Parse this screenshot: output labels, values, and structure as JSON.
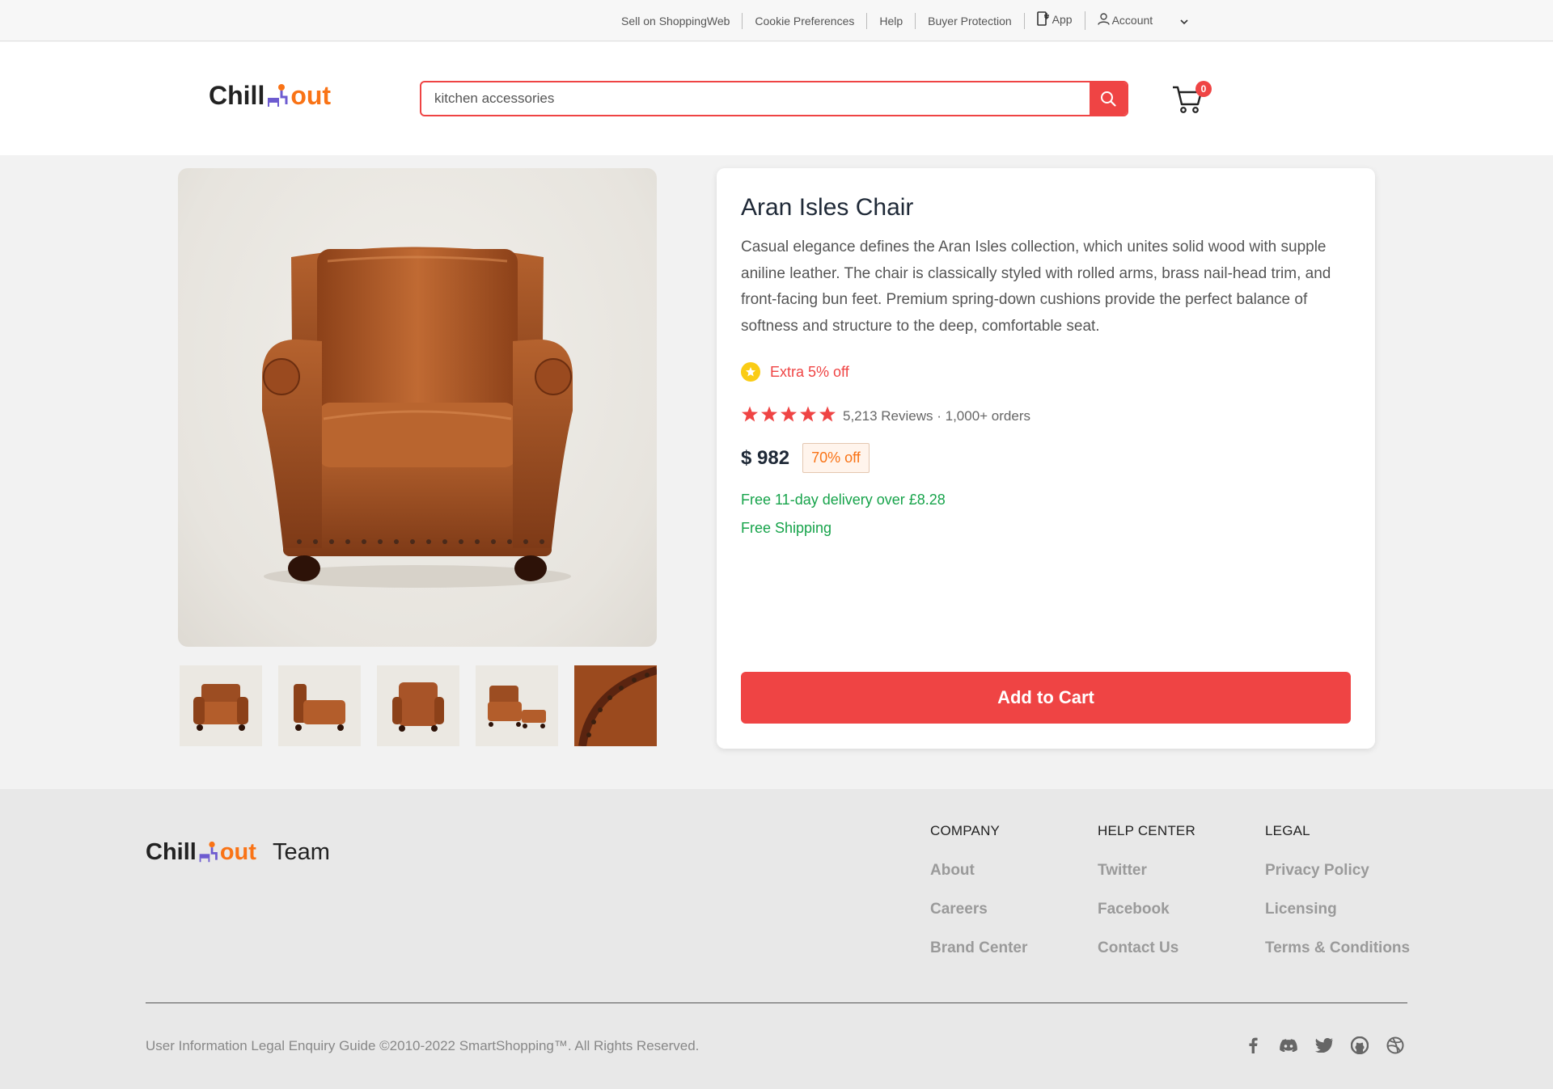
{
  "topbar": {
    "links": [
      "Sell on ShoppingWeb",
      "Cookie Preferences",
      "Help",
      "Buyer Protection"
    ],
    "app_label": "App",
    "account_label": "Account"
  },
  "header": {
    "logo_chill": "Chill",
    "logo_out": "out",
    "search_value": "kitchen accessories",
    "cart_count": "0"
  },
  "product": {
    "title": "Aran Isles Chair",
    "description": "Casual elegance defines the Aran Isles collection, which unites solid wood with supple aniline leather. The chair is classically styled with rolled arms, brass nail-head trim, and front-facing bun feet. Premium spring-down cushions provide the perfect balance of softness and structure to the deep, comfortable seat.",
    "promo": "Extra 5% off",
    "rating_stars": 5,
    "rating_text": "5,213 Reviews · 1,000+ orders",
    "price": "$ 982",
    "discount": "70% off",
    "delivery": "Free 11-day delivery over £8.28",
    "shipping": "Free Shipping",
    "add_to_cart": "Add to Cart",
    "thumbnail_views": [
      "front-angle",
      "side",
      "back",
      "with-ottoman",
      "closeup"
    ]
  },
  "footer": {
    "logo_chill": "Chill",
    "logo_out": "out",
    "team": "Team",
    "columns": [
      {
        "heading": "COMPANY",
        "links": [
          "About",
          "Careers",
          "Brand Center"
        ]
      },
      {
        "heading": "HELP CENTER",
        "links": [
          "Twitter",
          "Facebook",
          "Contact Us"
        ]
      },
      {
        "heading": "LEGAL",
        "links": [
          "Privacy Policy",
          "Licensing",
          "Terms & Conditions"
        ]
      }
    ],
    "copyright": "User Information Legal Enquiry Guide ©2010-2022 SmartShopping™. All Rights Reserved.",
    "social_icons": [
      "facebook-icon",
      "discord-icon",
      "twitter-icon",
      "github-icon",
      "dribbble-icon"
    ]
  },
  "colors": {
    "accent": "#ef4444",
    "logo_orange": "#f97316",
    "success": "#16a34a",
    "star": "#ef4444",
    "promo_badge": "#facc15"
  }
}
